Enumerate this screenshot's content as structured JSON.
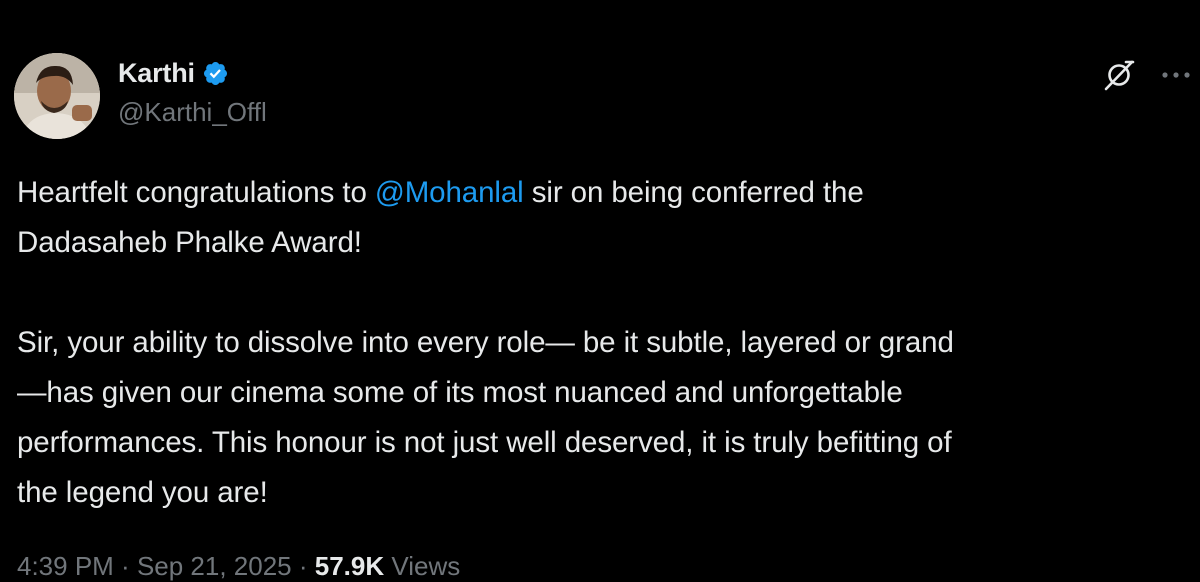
{
  "author": {
    "display_name": "Karthi",
    "handle": "@Karthi_Offl",
    "verified": true,
    "verified_color": "#1d9bf0"
  },
  "icons": {
    "verified": "verified-badge-icon",
    "grok": "grok-icon",
    "more": "more-options-icon"
  },
  "tweet": {
    "line1_pre": "Heartfelt congratulations to ",
    "mention": "@Mohanlal",
    "line1_post": " sir on being conferred the",
    "line2": "Dadasaheb Phalke Award!",
    "line3": "Sir, your ability to dissolve into every role— be it subtle, layered or grand",
    "line4": "—has given our cinema some of its most nuanced and unforgettable",
    "line5": "performances. This honour is not just well deserved, it is truly befitting of",
    "line6": "the legend you are!"
  },
  "meta": {
    "time": "4:39 PM",
    "separator": " · ",
    "date": "Sep 21, 2025",
    "views_count": "57.9K",
    "views_label": " Views"
  },
  "colors": {
    "background": "#000000",
    "text_primary": "#e7e9ea",
    "text_secondary": "#71767b",
    "link": "#1d9bf0"
  }
}
